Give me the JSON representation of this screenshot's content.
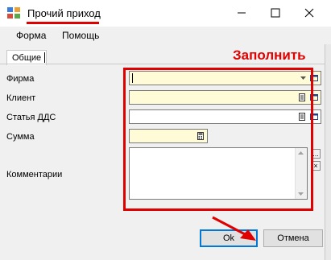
{
  "window": {
    "title": "Прочий приход",
    "controls": {
      "minimize": "–",
      "maximize": "☐",
      "close": "✕"
    }
  },
  "menu": {
    "items": [
      "Форма",
      "Помощь"
    ]
  },
  "tabs": [
    {
      "label": "Общие",
      "active": true
    }
  ],
  "annotation": {
    "text": "Заполнить",
    "color": "#e00000"
  },
  "form": {
    "fields": [
      {
        "label": "Фирма",
        "value": ""
      },
      {
        "label": "Клиент",
        "value": ""
      },
      {
        "label": "Статья ДДС",
        "value": ""
      },
      {
        "label": "Сумма",
        "value": ""
      },
      {
        "label": "Комментарии",
        "value": ""
      }
    ],
    "memo_side_buttons": [
      "...",
      "×"
    ]
  },
  "buttons": {
    "ok": "Ok",
    "cancel": "Отмена"
  },
  "colors": {
    "required_field_bg": "#fffbd6",
    "highlight": "#e00000",
    "focus": "#0078d7"
  }
}
